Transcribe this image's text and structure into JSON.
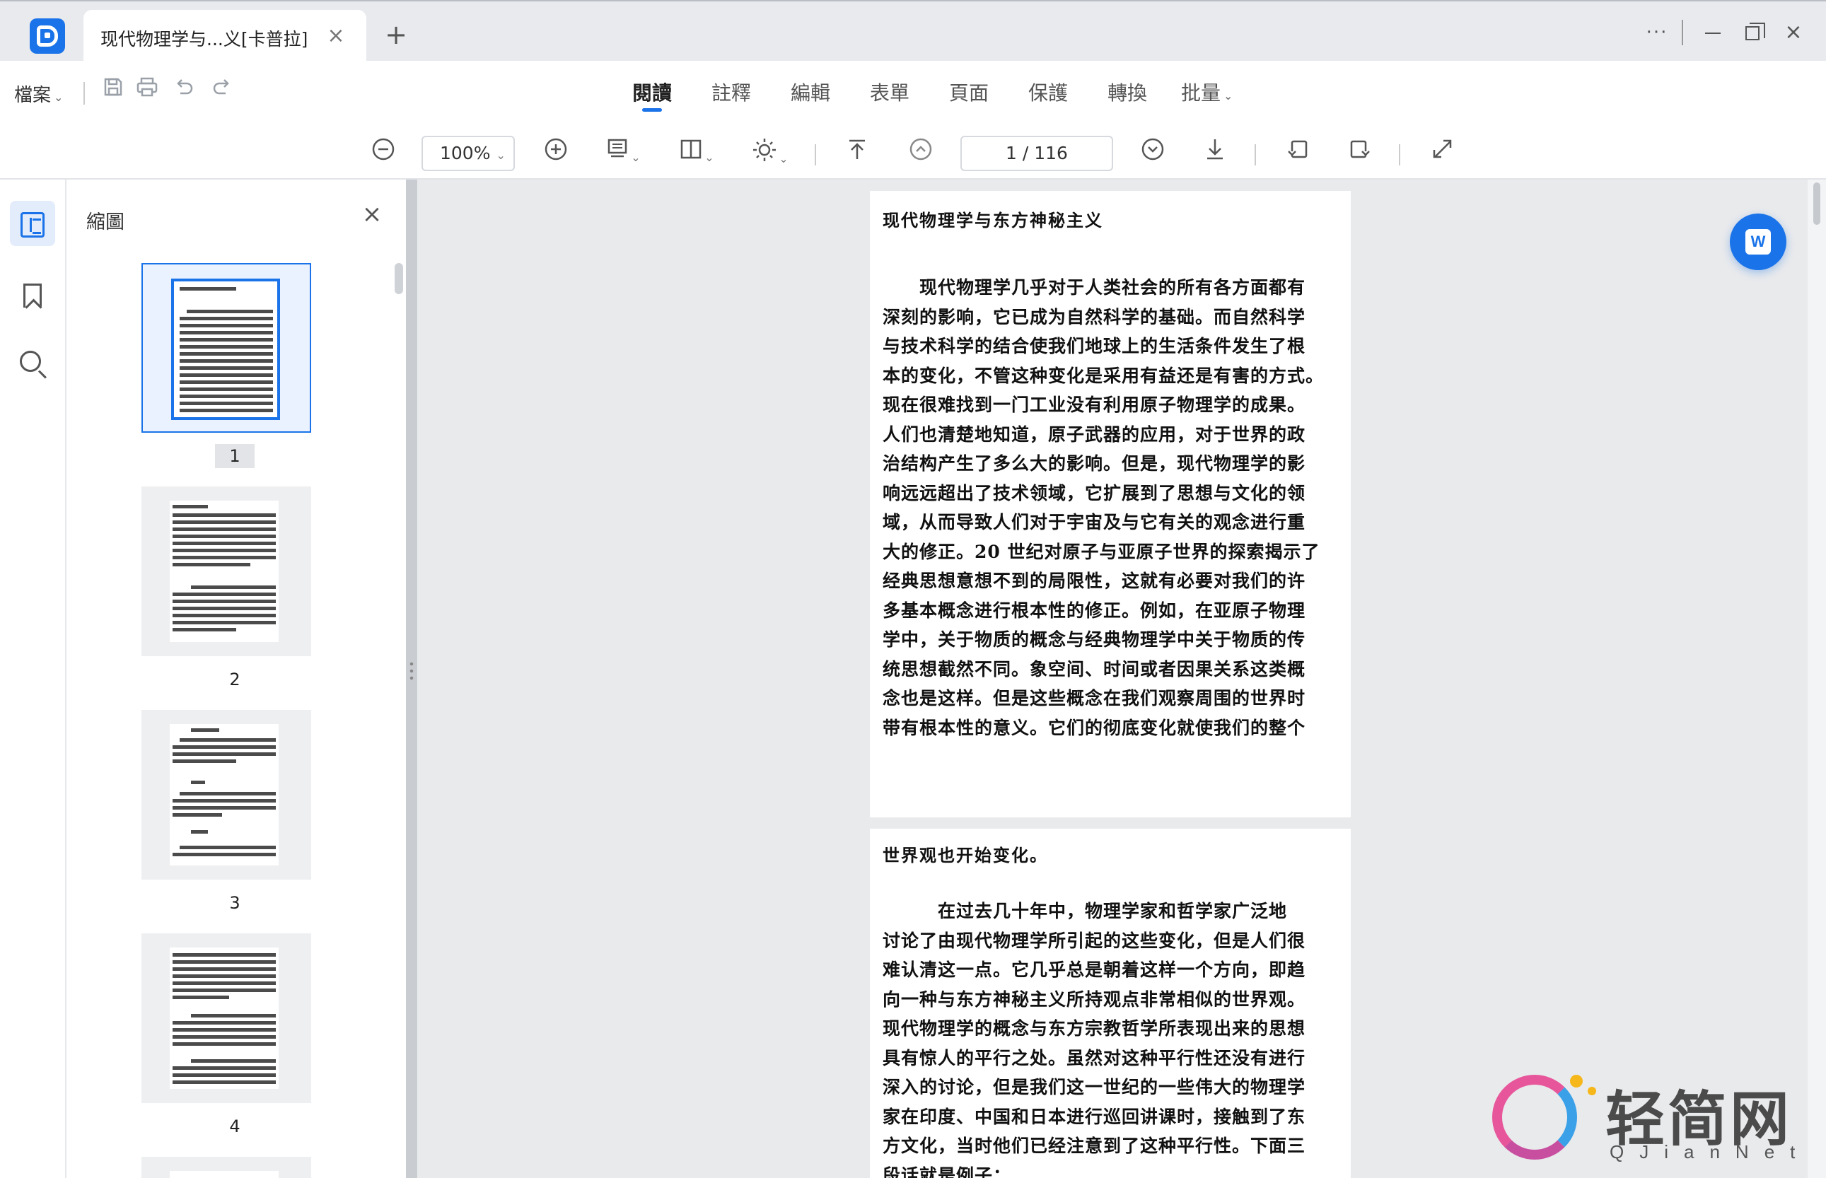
{
  "window": {
    "tab_title": "现代物理学与...义[卡普拉]",
    "tab_close_icon": "close-icon",
    "new_tab_icon": "plus-icon",
    "controls": [
      "more-icon",
      "minimize-icon",
      "maximize-icon",
      "close-icon"
    ]
  },
  "menu": {
    "file_label": "檔案",
    "quick_tools": [
      "save-icon",
      "print-icon",
      "undo-icon",
      "redo-icon"
    ],
    "tabs": [
      {
        "label": "閱讀",
        "active": true
      },
      {
        "label": "註釋",
        "active": false
      },
      {
        "label": "編輯",
        "active": false
      },
      {
        "label": "表單",
        "active": false
      },
      {
        "label": "頁面",
        "active": false
      },
      {
        "label": "保護",
        "active": false
      },
      {
        "label": "轉換",
        "active": false
      },
      {
        "label": "批量",
        "active": false,
        "dropdown": true
      }
    ]
  },
  "toolbar": {
    "zoom_value": "100%",
    "page_indicator": "1 / 116",
    "tools": [
      "zoom-out-icon",
      "zoom-in-icon",
      "page-mode-icon",
      "two-page-icon",
      "brightness-icon",
      "first-page-icon",
      "prev-page-icon",
      "next-page-icon",
      "last-page-icon",
      "rotate-left-icon",
      "rotate-right-icon",
      "fullscreen-icon"
    ]
  },
  "sidebar": {
    "rail": [
      "thumbnails-icon",
      "bookmark-icon",
      "search-icon"
    ],
    "panel_title": "縮圖",
    "thumbnails": [
      {
        "number": "1",
        "active": true
      },
      {
        "number": "2",
        "active": false
      },
      {
        "number": "3",
        "active": false
      },
      {
        "number": "4",
        "active": false
      }
    ]
  },
  "document": {
    "page1": {
      "title": "现代物理学与东方神秘主义",
      "lines": [
        "　　现代物理学几乎对于人类社会的所有各方面都有",
        "深刻的影响，它已成为自然科学的基础。而自然科学",
        "与技术科学的结合使我们地球上的生活条件发生了根",
        "本的变化，不管这种变化是采用有益还是有害的方式。",
        "现在很难找到一门工业没有利用原子物理学的成果。",
        "人们也清楚地知道，原子武器的应用，对于世界的政",
        "治结构产生了多么大的影响。但是，现代物理学的影",
        "响远远超出了技术领域，它扩展到了思想与文化的领",
        "域，从而导致人们对于宇宙及与它有关的观念进行重",
        "大的修正。20 世纪对原子与亚原子世界的探索揭示了",
        "经典思想意想不到的局限性，这就有必要对我们的许",
        "多基本概念进行根本性的修正。例如，在亚原子物理",
        "学中，关于物质的概念与经典物理学中关于物质的传",
        "统思想截然不同。象空间、时间或者因果关系这类概",
        "念也是这样。但是这些概念在我们观察周围的世界时",
        "带有根本性的意义。它们的彻底变化就使我们的整个"
      ]
    },
    "page2": {
      "first_line": "世界观也开始变化。",
      "lines": [
        "　　　在过去几十年中，物理学家和哲学家广泛地",
        "讨论了由现代物理学所引起的这些变化，但是人们很",
        "难认清这一点。它几乎总是朝着这样一个方向，即趋",
        "向一种与东方神秘主义所持观点非常相似的世界观。",
        "现代物理学的概念与东方宗教哲学所表现出来的思想",
        "具有惊人的平行之处。虽然对这种平行性还没有进行",
        "深入的讨论，但是我们这一世纪的一些伟大的物理学",
        "家在印度、中国和日本进行巡回讲课时，接触到了东",
        "方文化，当时他们已经注意到了这种平行性。下面三",
        "段话就是例子："
      ]
    },
    "word_button_icon": "word-convert-icon"
  },
  "watermark": {
    "text": "轻简网",
    "sub": "QJianNet"
  }
}
